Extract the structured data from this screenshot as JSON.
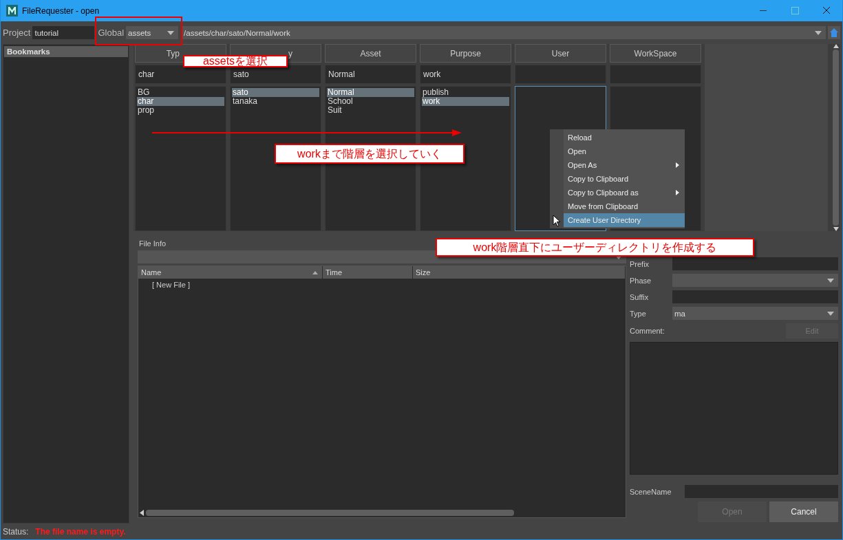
{
  "window": {
    "title": "FileRequester - open"
  },
  "toolbar": {
    "project_label": "Project",
    "project": "tutorial",
    "global_label": "Global",
    "global": "assets",
    "path": "/assets/char/sato/Normal/work"
  },
  "sidebar": {
    "items": [
      {
        "label": "Bookmarks",
        "selected": true
      }
    ]
  },
  "columns": [
    {
      "header": "Typ",
      "filter": "char",
      "focused": false,
      "items": [
        {
          "label": "BG",
          "selected": false
        },
        {
          "label": "char",
          "selected": true
        },
        {
          "label": "prop",
          "selected": false
        }
      ]
    },
    {
      "header": "y",
      "filter": "sato",
      "focused": false,
      "items": [
        {
          "label": "sato",
          "selected": true
        },
        {
          "label": "tanaka",
          "selected": false
        }
      ]
    },
    {
      "header": "Asset",
      "filter": "Normal",
      "focused": false,
      "items": [
        {
          "label": "Normal",
          "selected": true
        },
        {
          "label": "School",
          "selected": false
        },
        {
          "label": "Suit",
          "selected": false
        }
      ]
    },
    {
      "header": "Purpose",
      "filter": "work",
      "focused": false,
      "items": [
        {
          "label": "publish",
          "selected": false
        },
        {
          "label": "work",
          "selected": true
        }
      ]
    },
    {
      "header": "User",
      "focused": true
    },
    {
      "header": "WorkSpace",
      "focused": false
    }
  ],
  "context_menu": {
    "items": [
      {
        "label": "Reload",
        "submenu": false,
        "selected": false
      },
      {
        "label": "Open",
        "submenu": false,
        "selected": false
      },
      {
        "label": "Open As",
        "submenu": true,
        "selected": false
      },
      {
        "label": "Copy to Clipboard",
        "submenu": false,
        "selected": false
      },
      {
        "label": "Copy to Clipboard as",
        "submenu": true,
        "selected": false
      },
      {
        "label": "Move from Clipboard",
        "submenu": false,
        "selected": false
      },
      {
        "label": "Create User Directory",
        "submenu": false,
        "selected": true
      }
    ]
  },
  "file_info": {
    "title": "File Info",
    "table": {
      "columns": [
        {
          "label": "Name",
          "sorted": true
        },
        {
          "label": "Time",
          "sorted": false
        },
        {
          "label": "Size",
          "sorted": false
        }
      ],
      "rows": [
        [
          "[ New File ]"
        ]
      ]
    }
  },
  "form": {
    "prefix_label": "Prefix",
    "phase_label": "Phase",
    "suffix_label": "Suffix",
    "type_label": "Type",
    "type": "ma",
    "comment_label": "Comment:",
    "edit_button": {
      "label": "Edit",
      "disabled": true
    },
    "scene_label": "SceneName",
    "buttons": [
      {
        "label": "Open",
        "disabled": true
      },
      {
        "label": "Cancel",
        "disabled": false
      }
    ]
  },
  "status": {
    "label": "Status:",
    "message": "The file name is empty."
  },
  "annotations": [
    {
      "kind": "frame"
    },
    {
      "kind": "label",
      "text": "assetsを選択"
    },
    {
      "kind": "arrow"
    },
    {
      "kind": "label",
      "text": "workまで階層を選択していく"
    },
    {
      "kind": "label",
      "text": "work階層直下にユーザーディレクトリを作成する"
    }
  ]
}
